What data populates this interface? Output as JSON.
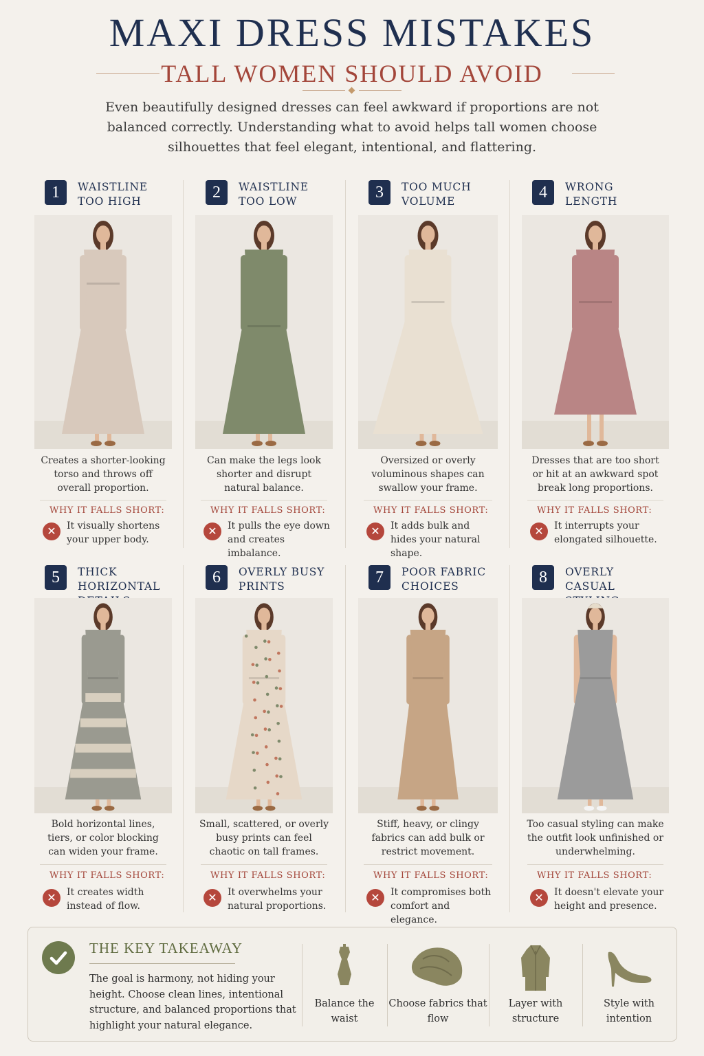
{
  "title": "MAXI DRESS MISTAKES",
  "subtitle": "TALL WOMEN SHOULD AVOID",
  "intro": "Even beautifully designed dresses can feel awkward if proportions are not balanced correctly. Understanding what to avoid helps tall women choose silhouettes that feel elegant, intentional, and flattering.",
  "why_label": "WHY IT FALLS SHORT:",
  "mistakes": [
    {
      "number": "1",
      "title": "WAISTLINE TOO HIGH",
      "description": "Creates a shorter-looking torso and throws off overall proportion.",
      "reason": "It visually shortens your upper body.",
      "dress_color": "#d8c9bc"
    },
    {
      "number": "2",
      "title": "WAISTLINE TOO LOW",
      "description": "Can make the legs look shorter and disrupt natural balance.",
      "reason": "It pulls the eye down and creates imbalance.",
      "dress_color": "#7f8a6b"
    },
    {
      "number": "3",
      "title": "TOO MUCH VOLUME",
      "description": "Oversized or overly voluminous shapes can swallow your frame.",
      "reason": "It adds bulk and hides your natural shape.",
      "dress_color": "#e9e0d2"
    },
    {
      "number": "4",
      "title": "WRONG LENGTH",
      "description": "Dresses that are too short or hit at an awkward spot break long proportions.",
      "reason": "It interrupts your elongated silhouette.",
      "dress_color": "#b98585"
    },
    {
      "number": "5",
      "title": "THICK HORIZONTAL DETAILS",
      "description": "Bold horizontal lines, tiers, or color blocking can widen your frame.",
      "reason": "It creates width instead of flow.",
      "dress_color": "#9a9a90"
    },
    {
      "number": "6",
      "title": "OVERLY BUSY PRINTS",
      "description": "Small, scattered, or overly busy prints can feel chaotic on tall frames.",
      "reason": "It overwhelms your natural proportions.",
      "dress_color": "#e6d8c8"
    },
    {
      "number": "7",
      "title": "POOR FABRIC CHOICES",
      "description": "Stiff, heavy, or clingy fabrics can add bulk or restrict movement.",
      "reason": "It compromises both comfort and elegance.",
      "dress_color": "#c6a585"
    },
    {
      "number": "8",
      "title": "OVERLY CASUAL STYLING",
      "description": "Too casual styling can make the outfit look unfinished or underwhelming.",
      "reason": "It doesn't elevate your height and presence.",
      "dress_color": "#9b9b9b"
    }
  ],
  "takeaway": {
    "title": "THE KEY TAKEAWAY",
    "text": "The goal is harmony, not hiding your height. Choose clean lines, intentional structure, and balanced proportions that highlight your natural elegance.",
    "tips": [
      {
        "label": "Balance the waist",
        "icon": "dress-form-icon"
      },
      {
        "label": "Choose fabrics that flow",
        "icon": "fabric-icon"
      },
      {
        "label": "Layer with structure",
        "icon": "coat-icon"
      },
      {
        "label": "Style with intention",
        "icon": "heel-icon"
      }
    ],
    "accent_color": "#6e7a4e"
  },
  "colors": {
    "navy": "#1f2f4f",
    "red": "#a3463a",
    "olive": "#6e7a4e"
  }
}
